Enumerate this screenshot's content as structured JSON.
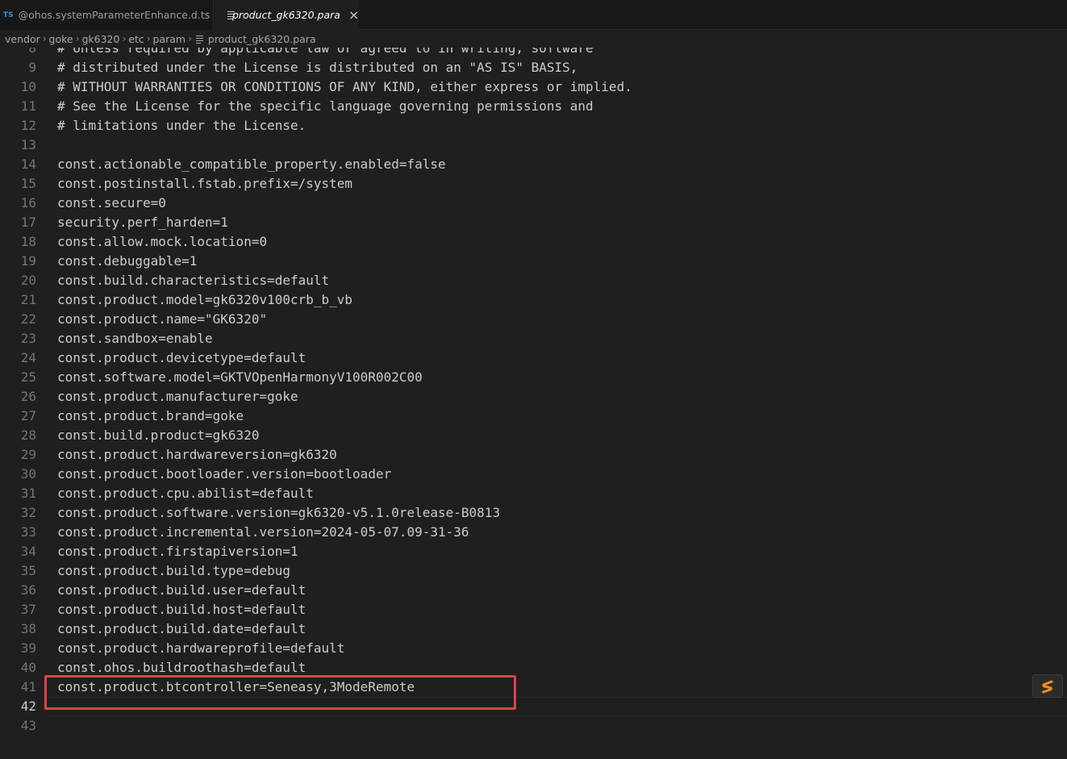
{
  "tabs": [
    {
      "badge": "TS",
      "label": "@ohos.systemParameterEnhance.d.ts",
      "active": false
    },
    {
      "label": "product_gk6320.para",
      "active": true,
      "close": "×"
    }
  ],
  "breadcrumb": [
    "vendor",
    "goke",
    "gk6320",
    "etc",
    "param",
    "product_gk6320.para"
  ],
  "editor": {
    "active_line": 42,
    "lines": [
      {
        "num": "8",
        "text": "# Unless required by applicable law or agreed to in writing, software"
      },
      {
        "num": "9",
        "text": "# distributed under the License is distributed on an \"AS IS\" BASIS,"
      },
      {
        "num": "10",
        "text": "# WITHOUT WARRANTIES OR CONDITIONS OF ANY KIND, either express or implied."
      },
      {
        "num": "11",
        "text": "# See the License for the specific language governing permissions and"
      },
      {
        "num": "12",
        "text": "# limitations under the License."
      },
      {
        "num": "13",
        "text": ""
      },
      {
        "num": "14",
        "text": "const.actionable_compatible_property.enabled=false"
      },
      {
        "num": "15",
        "text": "const.postinstall.fstab.prefix=/system"
      },
      {
        "num": "16",
        "text": "const.secure=0"
      },
      {
        "num": "17",
        "text": "security.perf_harden=1"
      },
      {
        "num": "18",
        "text": "const.allow.mock.location=0"
      },
      {
        "num": "19",
        "text": "const.debuggable=1"
      },
      {
        "num": "20",
        "text": "const.build.characteristics=default"
      },
      {
        "num": "21",
        "text": "const.product.model=gk6320v100crb_b_vb"
      },
      {
        "num": "22",
        "text": "const.product.name=\"GK6320\""
      },
      {
        "num": "23",
        "text": "const.sandbox=enable"
      },
      {
        "num": "24",
        "text": "const.product.devicetype=default"
      },
      {
        "num": "25",
        "text": "const.software.model=GKTVOpenHarmonyV100R002C00"
      },
      {
        "num": "26",
        "text": "const.product.manufacturer=goke"
      },
      {
        "num": "27",
        "text": "const.product.brand=goke"
      },
      {
        "num": "28",
        "text": "const.build.product=gk6320"
      },
      {
        "num": "29",
        "text": "const.product.hardwareversion=gk6320"
      },
      {
        "num": "30",
        "text": "const.product.bootloader.version=bootloader"
      },
      {
        "num": "31",
        "text": "const.product.cpu.abilist=default"
      },
      {
        "num": "32",
        "text": "const.product.software.version=gk6320-v5.1.0release-B0813"
      },
      {
        "num": "33",
        "text": "const.product.incremental.version=2024-05-07.09-31-36"
      },
      {
        "num": "34",
        "text": "const.product.firstapiversion=1"
      },
      {
        "num": "35",
        "text": "const.product.build.type=debug"
      },
      {
        "num": "36",
        "text": "const.product.build.user=default"
      },
      {
        "num": "37",
        "text": "const.product.build.host=default"
      },
      {
        "num": "38",
        "text": "const.product.build.date=default"
      },
      {
        "num": "39",
        "text": "const.product.hardwareprofile=default"
      },
      {
        "num": "40",
        "text": "const.ohos.buildroothash=default"
      },
      {
        "num": "41",
        "text": "const.product.btcontroller=Seneasy,3ModeRemote"
      },
      {
        "num": "42",
        "text": ""
      },
      {
        "num": "43",
        "text": ""
      }
    ]
  },
  "floating_button": {
    "icon": "sublime-s-icon"
  },
  "colors": {
    "highlight": "#e0424b",
    "accent": "#ff8c1a"
  }
}
